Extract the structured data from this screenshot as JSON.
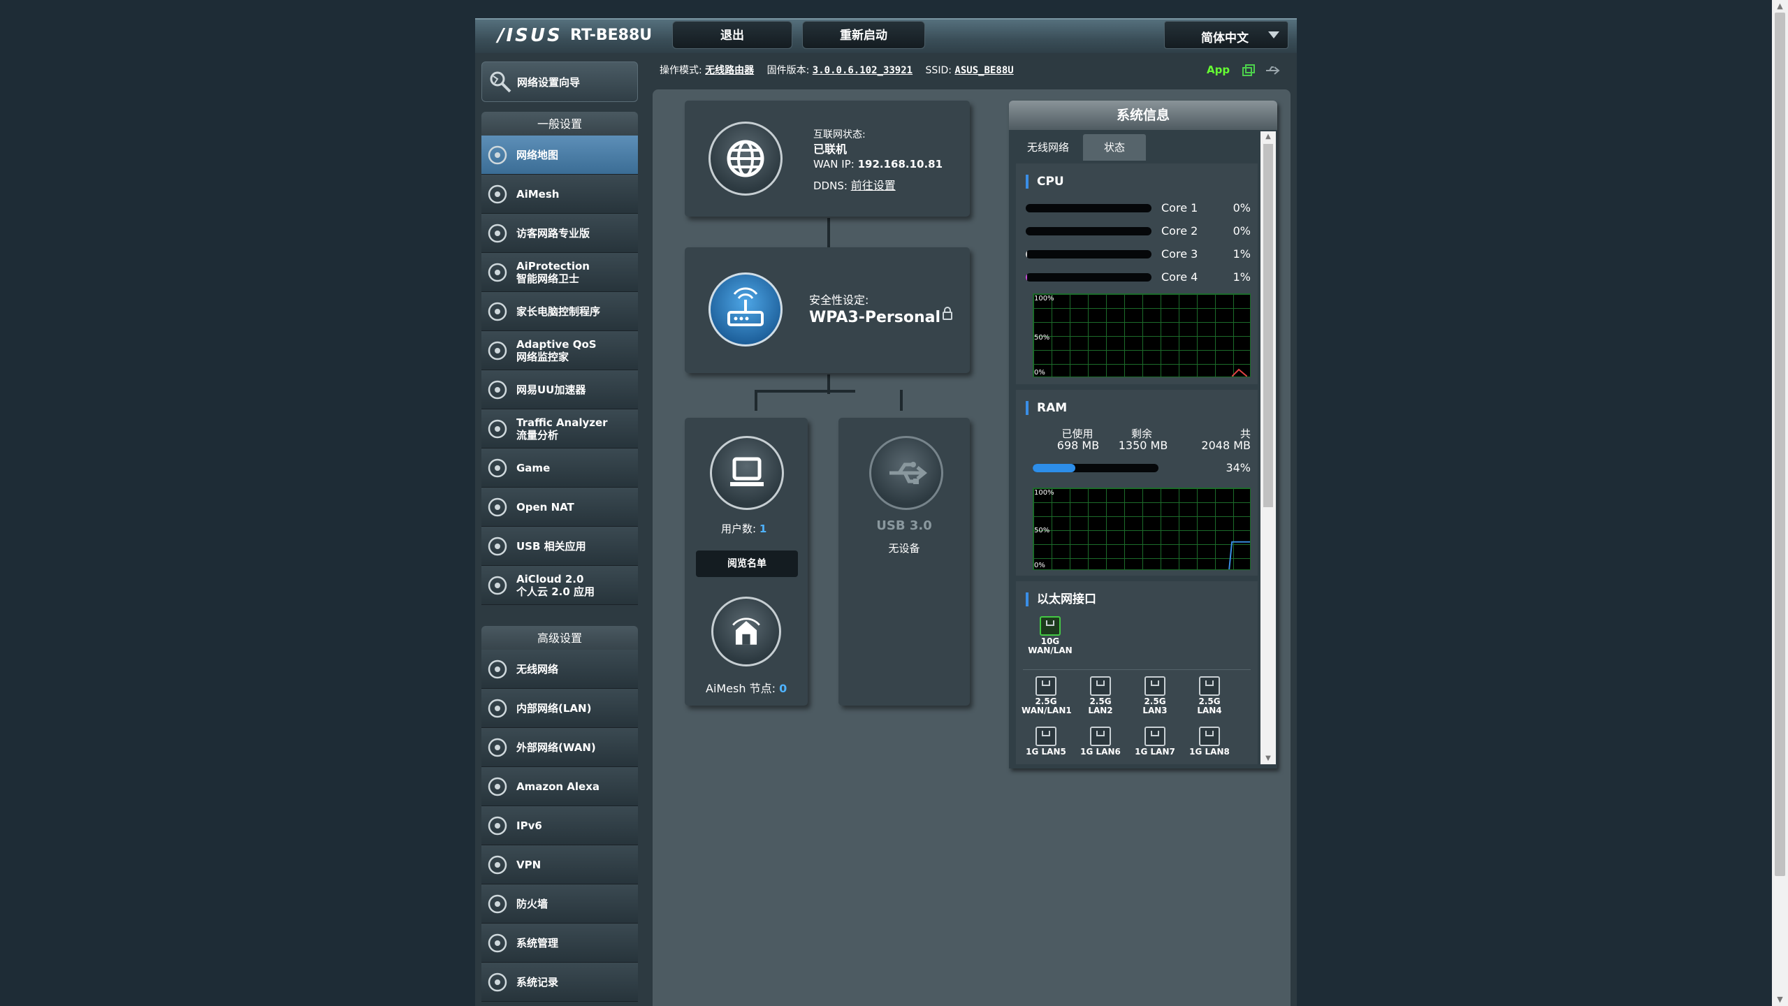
{
  "header": {
    "logo": "/ISUS",
    "model": "RT-BE88U",
    "logout_label": "退出",
    "reboot_label": "重新启动",
    "language": "简体中文"
  },
  "infobar": {
    "mode_label": "操作模式:",
    "mode_value": "无线路由器",
    "firmware_label": "固件版本:",
    "firmware_value": "3.0.0.6.102_33921",
    "ssid_label": "SSID:",
    "ssid_value": "ASUS_BE88U",
    "app_label": "App"
  },
  "sidebar": {
    "wizard_label": "网络设置向导",
    "general_heading": "一般设置",
    "general_items": [
      {
        "line1": "网络地图",
        "line2": ""
      },
      {
        "line1": "AiMesh",
        "line2": ""
      },
      {
        "line1": "访客网路专业版",
        "line2": ""
      },
      {
        "line1": "AiProtection",
        "line2": "智能网络卫士"
      },
      {
        "line1": "家长电脑控制程序",
        "line2": ""
      },
      {
        "line1": "Adaptive QoS",
        "line2": "网络监控家"
      },
      {
        "line1": "网易UU加速器",
        "line2": ""
      },
      {
        "line1": "Traffic Analyzer",
        "line2": "流量分析"
      },
      {
        "line1": "Game",
        "line2": ""
      },
      {
        "line1": "Open NAT",
        "line2": ""
      },
      {
        "line1": "USB 相关应用",
        "line2": ""
      },
      {
        "line1": "AiCloud 2.0",
        "line2": "个人云 2.0 应用"
      }
    ],
    "advanced_heading": "高级设置",
    "advanced_items": [
      {
        "line1": "无线网络"
      },
      {
        "line1": "内部网络(LAN)"
      },
      {
        "line1": "外部网络(WAN)"
      },
      {
        "line1": "Amazon Alexa"
      },
      {
        "line1": "IPv6"
      },
      {
        "line1": "VPN"
      },
      {
        "line1": "防火墙"
      },
      {
        "line1": "系统管理"
      },
      {
        "line1": "系统记录"
      }
    ]
  },
  "network_map": {
    "internet_status_label": "互联网状态:",
    "internet_status_value": "已联机",
    "wan_ip_label": "WAN IP:",
    "wan_ip_value": "192.168.10.81",
    "ddns_label": "DDNS:",
    "ddns_value": "前往设置",
    "security_label": "安全性设定:",
    "security_value": "WPA3-Personal",
    "clients_label": "用户数:",
    "clients_value": "1",
    "view_list_label": "阅览名单",
    "aimesh_label": "AiMesh 节点:",
    "aimesh_value": "0",
    "usb_label": "USB 3.0",
    "usb_status": "无设备"
  },
  "system_info": {
    "title": "系统信息",
    "tabs": [
      "无线网络",
      "状态"
    ],
    "cpu_title": "CPU",
    "cores": [
      {
        "name": "Core 1",
        "value": "0%",
        "fill": 0
      },
      {
        "name": "Core 2",
        "value": "0%",
        "fill": 0
      },
      {
        "name": "Core 3",
        "value": "1%",
        "fill": 1
      },
      {
        "name": "Core 4",
        "value": "1%",
        "fill": 1
      }
    ],
    "graph_labels": [
      "100%",
      "50%",
      "0%"
    ],
    "ram_title": "RAM",
    "ram_used_label": "已使用",
    "ram_used_value": "698 MB",
    "ram_free_label": "剩余",
    "ram_free_value": "1350 MB",
    "ram_total_label": "共",
    "ram_total_value": "2048 MB",
    "ram_pct": "34%",
    "ram_fill": 34,
    "eth_title": "以太网接口",
    "wan_port": {
      "line1": "10G",
      "line2": "WAN/LAN"
    },
    "ports_row1": [
      {
        "line1": "2.5G",
        "line2": "WAN/LAN1"
      },
      {
        "line1": "2.5G LAN2",
        "line2": ""
      },
      {
        "line1": "2.5G LAN3",
        "line2": ""
      },
      {
        "line1": "2.5G LAN4",
        "line2": ""
      }
    ],
    "ports_row2": [
      {
        "line1": "1G LAN5"
      },
      {
        "line1": "1G LAN6"
      },
      {
        "line1": "1G LAN7"
      },
      {
        "line1": "1G LAN8"
      }
    ]
  },
  "colors": {
    "accent": "#3a8ee6",
    "active_menu": "#4d80aa",
    "graph_grid": "#1c6b2a",
    "app_label": "#66ff33"
  }
}
